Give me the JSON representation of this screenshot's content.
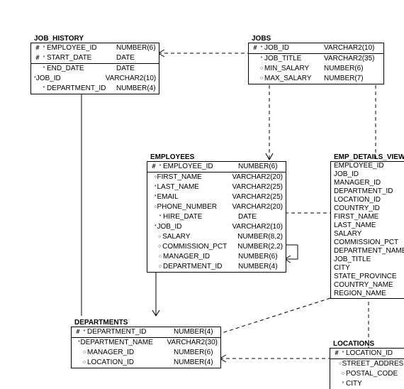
{
  "entities": {
    "job_history": {
      "title": "JOB_HISTORY",
      "header": [
        {
          "mark": "#",
          "sym": "*",
          "name": "EMPLOYEE_ID",
          "type": "NUMBER(6)"
        },
        {
          "mark": "#",
          "sym": "*",
          "name": "START_DATE",
          "type": "DATE"
        }
      ],
      "body": [
        {
          "mark": "",
          "sym": "*",
          "name": "END_DATE",
          "type": "DATE"
        },
        {
          "mark": "",
          "sym": "*",
          "name": "JOB_ID",
          "type": "VARCHAR2(10)"
        },
        {
          "mark": "",
          "sym": "*",
          "name": "DEPARTMENT_ID",
          "type": "NUMBER(4)"
        }
      ]
    },
    "jobs": {
      "title": "JOBS",
      "header": [
        {
          "mark": "#",
          "sym": "*",
          "name": "JOB_ID",
          "type": "VARCHAR2(10)"
        }
      ],
      "body": [
        {
          "mark": "",
          "sym": "*",
          "name": "JOB_TITLE",
          "type": "VARCHAR2(35)"
        },
        {
          "mark": "",
          "sym": "○",
          "name": "MIN_SALARY",
          "type": "NUMBER(6)"
        },
        {
          "mark": "",
          "sym": "○",
          "name": "MAX_SALARY",
          "type": "NUMBER(7)"
        }
      ]
    },
    "employees": {
      "title": "EMPLOYEES",
      "header": [
        {
          "mark": "#",
          "sym": "*",
          "name": "EMPLOYEE_ID",
          "type": "NUMBER(6)"
        }
      ],
      "body": [
        {
          "mark": "",
          "sym": "○",
          "name": "FIRST_NAME",
          "type": "VARCHAR2(20)"
        },
        {
          "mark": "",
          "sym": "*",
          "name": "LAST_NAME",
          "type": "VARCHAR2(25)"
        },
        {
          "mark": "",
          "sym": "*",
          "name": "EMAIL",
          "type": "VARCHAR2(25)"
        },
        {
          "mark": "",
          "sym": "○",
          "name": "PHONE_NUMBER",
          "type": "VARCHAR2(20)"
        },
        {
          "mark": "",
          "sym": "*",
          "name": "HIRE_DATE",
          "type": "DATE"
        },
        {
          "mark": "",
          "sym": "*",
          "name": "JOB_ID",
          "type": "VARCHAR2(10)"
        },
        {
          "mark": "",
          "sym": "○",
          "name": "SALARY",
          "type": "NUMBER(8,2)"
        },
        {
          "mark": "",
          "sym": "○",
          "name": "COMMISSION_PCT",
          "type": "NUMBER(2,2)"
        },
        {
          "mark": "",
          "sym": "○",
          "name": "MANAGER_ID",
          "type": "NUMBER(6)"
        },
        {
          "mark": "",
          "sym": "○",
          "name": "DEPARTMENT_ID",
          "type": "NUMBER(4)"
        }
      ]
    },
    "emp_details_view": {
      "title": "EMP_DETAILS_VIEW",
      "cols": [
        "EMPLOYEE_ID",
        "JOB_ID",
        "MANAGER_ID",
        "DEPARTMENT_ID",
        "LOCATION_ID",
        "COUNTRY_ID",
        "FIRST_NAME",
        "LAST_NAME",
        "SALARY",
        "COMMISSION_PCT",
        "DEPARTMENT_NAME",
        "JOB_TITLE",
        "CITY",
        "STATE_PROVINCE",
        "COUNTRY_NAME",
        "REGION_NAME"
      ]
    },
    "departments": {
      "title": "DEPARTMENTS",
      "header": [
        {
          "mark": "#",
          "sym": "*",
          "name": "DEPARTMENT_ID",
          "type": "NUMBER(4)"
        }
      ],
      "body": [
        {
          "mark": "",
          "sym": "*",
          "name": "DEPARTMENT_NAME",
          "type": "VARCHAR2(30)"
        },
        {
          "mark": "",
          "sym": "○",
          "name": "MANAGER_ID",
          "type": "NUMBER(6)"
        },
        {
          "mark": "",
          "sym": "○",
          "name": "LOCATION_ID",
          "type": "NUMBER(4)"
        }
      ]
    },
    "locations": {
      "title": "LOCATIONS",
      "header": [
        {
          "mark": "#",
          "sym": "*",
          "name": "LOCATION_ID",
          "type": ""
        }
      ],
      "body": [
        {
          "mark": "",
          "sym": "○",
          "name": "STREET_ADDRESS",
          "type": ""
        },
        {
          "mark": "",
          "sym": "○",
          "name": "POSTAL_CODE",
          "type": ""
        },
        {
          "mark": "",
          "sym": "*",
          "name": "CITY",
          "type": ""
        }
      ]
    }
  }
}
